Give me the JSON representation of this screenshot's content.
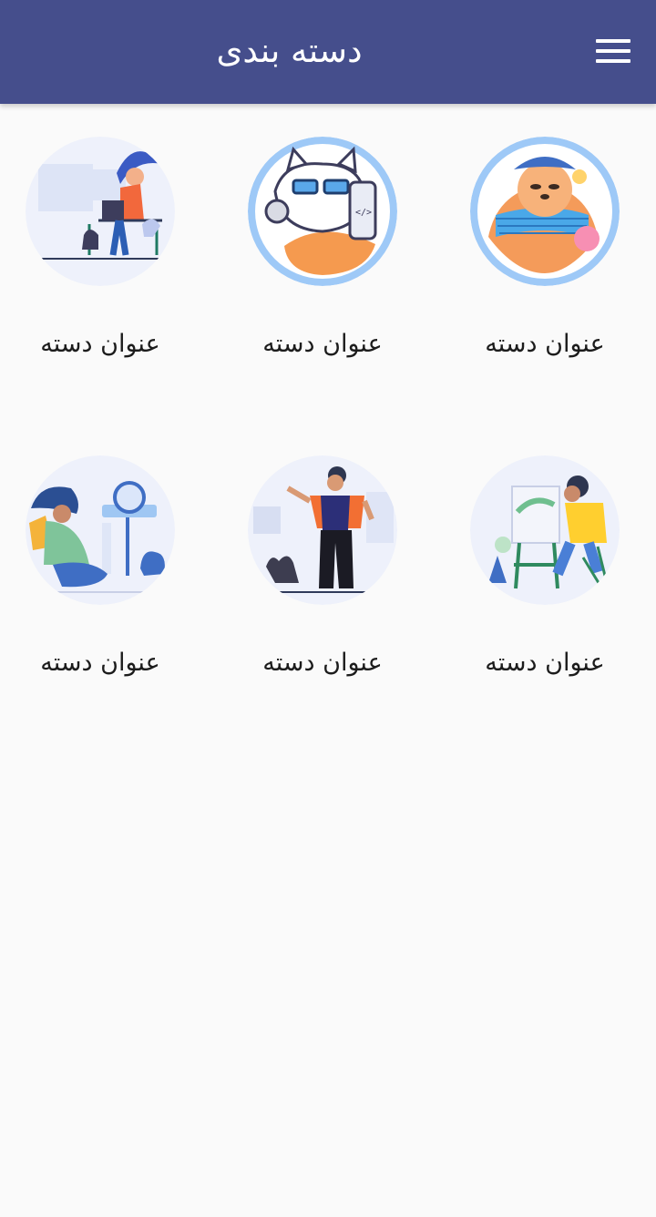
{
  "app_bar": {
    "title": "دسته بندی",
    "menu_icon": "hamburger-menu-icon",
    "background": "#454e8c"
  },
  "categories": [
    {
      "title": "عنوان دسته",
      "image": "sloth-painter-illustration"
    },
    {
      "title": "عنوان دسته",
      "image": "cat-developer-illustration"
    },
    {
      "title": "عنوان دسته",
      "image": "woman-laptop-desk-illustration"
    },
    {
      "title": "عنوان دسته",
      "image": "man-painting-easel-illustration"
    },
    {
      "title": "عنوان دسته",
      "image": "man-standing-with-cat-illustration"
    },
    {
      "title": "عنوان دسته",
      "image": "woman-sitting-with-cat-illustration"
    }
  ]
}
